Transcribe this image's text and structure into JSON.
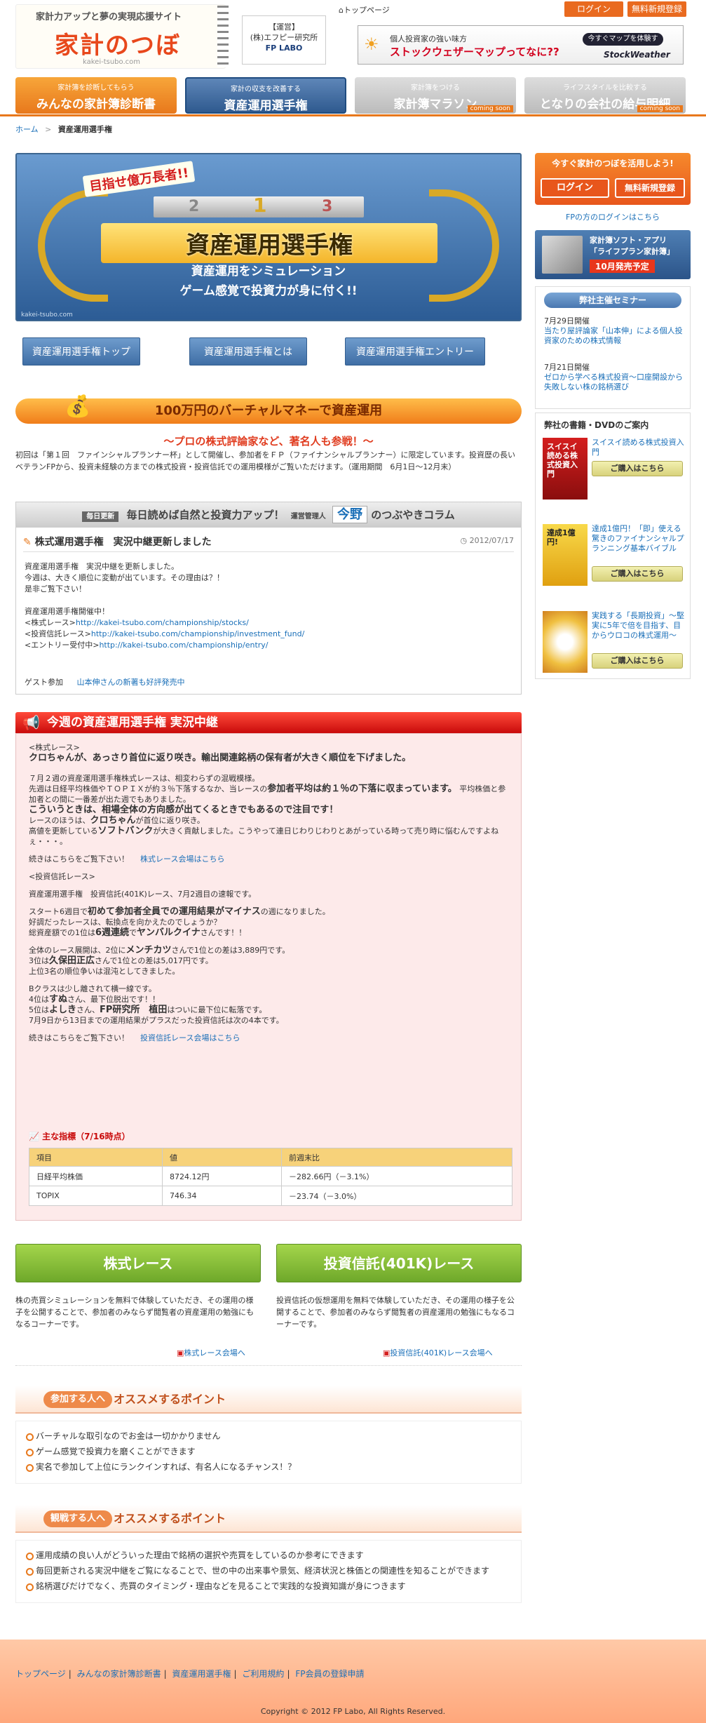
{
  "header": {
    "tagline": "家計力アップと夢の実現応援サイト",
    "logo": "家計のつぼ",
    "logo_sub": "kakei-tsubo.com",
    "sponsor_label": "【運営】",
    "sponsor_name": "(株)エフピー研究所",
    "sponsor_logo": "FP LABO",
    "top_link": "トップページ",
    "login": "ログイン",
    "register": "無料新規登録",
    "ad_line1": "個人投資家の強い味方",
    "ad_line2": "ストックウェザーマップってなに??",
    "ad_btn": "今すぐマップを体験する!!",
    "ad_logo": "StockWeather"
  },
  "nav": [
    {
      "sub": "家計簿を診断してもらう",
      "main": "みんなの家計簿診断書",
      "soon": ""
    },
    {
      "sub": "家計の収支を改善する",
      "main": "資産運用選手権",
      "soon": ""
    },
    {
      "sub": "家計簿をつける",
      "main": "家計簿マラソン",
      "soon": "coming soon"
    },
    {
      "sub": "ライフスタイルを比較する",
      "main": "となりの会社の給与明細",
      "soon": "coming soon"
    }
  ],
  "breadcrumb": {
    "home": "ホーム",
    "sep": ">",
    "current": "資産運用選手権"
  },
  "hero": {
    "tag": "目指せ億万長者!!",
    "title": "資産運用選手権",
    "sub1": "資産運用をシミュレーション",
    "sub2": "ゲーム感覚で投資力が身に付く!!",
    "url": "kakei-tsubo.com",
    "p1": "1",
    "p2": "2",
    "p3": "3"
  },
  "subnav": [
    "資産運用選手権トップ",
    "資産運用選手権とは",
    "資産運用選手権エントリー"
  ],
  "section": {
    "banner": "100万円のバーチャルマネーで資産運用",
    "pro_title": "～プロの株式評論家など、著名人も参戦！～",
    "intro": "初回は「第１回　ファインシャルプランナー杯」として開催し、参加者をＦＰ（ファイナンシャルプランナー）に限定しています。投資歴の長いベテランFPから、投資未経験の方までの株式投資・投資信託での運用模様がご覧いただけます。（運用期間　6月1日～12月末）"
  },
  "column": {
    "badge": "毎日更新",
    "head": "毎日読めば自然と投資力アップ！",
    "role": "運営管理人",
    "name": "今野",
    "suffix": "のつぶやきコラム",
    "post_title": "株式運用選手権　実況中継更新しました",
    "date": "2012/07/17",
    "body1": "資産運用選手権　実況中継を更新しました。",
    "body2": "今週は、大きく順位に変動が出ています。その理由は？！",
    "body3": "是非ご覧下さい！",
    "body4": "資産運用選手権開催中！",
    "stock_label": "<株式レース>",
    "stock_url": "http://kakei-tsubo.com/championship/stocks/",
    "fund_label": "<投資信託レース>",
    "fund_url": "http://kakei-tsubo.com/championship/investment_fund/",
    "entry_label": "<エントリー受付中>",
    "entry_url": "http://kakei-tsubo.com/championship/entry/",
    "guest_label": "ゲスト参加",
    "guest_link": "山本伸さんの新著も好評発売中"
  },
  "live": {
    "head": "今週の資産運用選手権 実況中継",
    "stock_tag": "<株式レース>",
    "lead": "クロちゃんが、あっさり首位に返り咲き。輸出関連銘柄の保有者が大きく順位を下げました。",
    "p1a": "７月２週の資産運用選手権株式レースは、相変わらずの混戦模様。",
    "p1b": "先週は日経平均株価やＴＯＰＩＸが約３％下落するなか、当レースの",
    "p1c": "参加者平均は約１％の下落に収まっています。",
    "p1d": "平均株価と参加者との間に一番差が出た週でもありました。",
    "p1e": "こういうときは、相場全体の方向感が出てくるときでもあるので注目です！",
    "p1f": "レースのほうは、",
    "p1g": "クロちゃん",
    "p1h": "が首位に返り咲き。",
    "p1i": "高値を更新している",
    "p1j": "ソフトバンク",
    "p1k": "が大きく貢献しました。こうやって連日じわりじわりとあがっている時って売り時に悩むんですよねぇ・・・。",
    "more1": "続きはこちらをご覧下さい！",
    "more1_link": "株式レース会場はこちら",
    "fund_tag": "<投資信託レース>",
    "f1": "資産運用選手権　投資信託(401K)レース、7月2週目の速報です。",
    "f2a": "スタート6週目で",
    "f2b": "初めて参加者全員での運用結果がマイナス",
    "f2c": "の週になりました。",
    "f2d": "好調だったレースは、転換点を向かえたのでしょうか？",
    "f2e": "総資産額での1位は",
    "f2f": "6週連続",
    "f2g": "で",
    "f2h": "ヤンバルクイナ",
    "f2i": "さんです！！",
    "f3a": "全体のレース展開は、2位に",
    "f3b": "メンチカツ",
    "f3c": "さんで1位との差は3,889円です。",
    "f3d": "3位は",
    "f3e": "久保田正広",
    "f3f": "さんで1位との差は5,017円です。",
    "f3g": "上位3名の順位争いは混沌としてきました。",
    "f4a": "Bクラスは少し離されて横一線です。",
    "f4b": "4位は",
    "f4c": "すぬ",
    "f4d": "さん、最下位脱出です！！",
    "f4e": "5位は",
    "f4f": "よしき",
    "f4g": "さん、",
    "f4h": "FP研究所　植田",
    "f4i": "はついに最下位に転落です。",
    "f4j": "7月9日から13日までの運用結果がプラスだった投資信託は次の4本です。",
    "more2": "続きはこちらをご覧下さい！",
    "more2_link": "投資信託レース会場はこちら",
    "idx_title": "主な指標（7/16時点）",
    "cols": [
      "項目",
      "値",
      "前週末比"
    ],
    "rows": [
      [
        "日経平均株価",
        "8724.12円",
        "－282.66円（－3.1%）"
      ],
      [
        "TOPIX",
        "746.34",
        "－23.74（－3.0%）"
      ]
    ]
  },
  "races": [
    {
      "title": "株式レース",
      "desc": "株の売買シミュレーションを無料で体験していただき、その運用の様子を公開することで、参加者のみならず閲覧者の資産運用の勉強にもなるコーナーです。",
      "link": "株式レース会場へ"
    },
    {
      "title": "投資信託(401K)レース",
      "desc": "投資信託の仮想運用を無料で体験していただき、その運用の様子を公開することで、参加者のみならず閲覧者の資産運用の勉強にもなるコーナーです。",
      "link": "投資信託(401K)レース会場へ"
    }
  ],
  "rec1": {
    "badge": "参加する人へ",
    "title": "オススメするポイント",
    "items": [
      "バーチャルな取引なのでお金は一切かかりません",
      "ゲーム感覚で投資力を磨くことができます",
      "実名で参加して上位にランクインすれば、有名人になるチャンス！？"
    ]
  },
  "rec2": {
    "badge": "観戦する人へ",
    "title": "オススメするポイント",
    "items": [
      "運用成績の良い人がどういった理由で銘柄の選択や売買をしているのか参考にできます",
      "毎回更新される実況中継をご覧になることで、世の中の出来事や景気、経済状況と株価との関連性を知ることができます",
      "銘柄選びだけでなく、売買のタイミング・理由などを見ることで実践的な投資知識が身につきます"
    ]
  },
  "sidebar": {
    "box_title": "今すぐ家計のつぼを活用しよう!",
    "login": "ログイン",
    "register": "無料新規登録",
    "fp_login": "FPの方のログインはこちら",
    "app1": "家計簿ソフト・アプリ",
    "app2": "「ライフプラン家計簿」",
    "app3": "10月発売予定",
    "seminar_head": "弊社主催セミナー",
    "seminars": [
      {
        "date": "7月29日開催",
        "title": "当たり屋評論家「山本伸」による個人投資家のための株式情報"
      },
      {
        "date": "7月21日開催",
        "title": "ゼロから学べる株式投資～口座開設から失敗しない株の銘柄選び"
      }
    ],
    "books_head": "弊社の書籍・DVDのご案内",
    "buy": "ご購入はこちら",
    "books": [
      {
        "title": "スイスイ読める株式投資入門",
        "cover": "スイスイ読める株式投資入門"
      },
      {
        "title": "達成1億円！「即」使える驚きのファイナンシャルプランニング基本バイブル",
        "cover": "達成1億円!"
      },
      {
        "title": "実践する「長期投資」～堅実に5年で倍を目指す、目からウロコの株式運用～",
        "cover": ""
      }
    ]
  },
  "footer": {
    "links": [
      "トップページ",
      "みんなの家計簿診断書",
      "資産運用選手権",
      "ご利用規約",
      "FP会員の登録申請"
    ],
    "sep": "|",
    "copy": "Copyright © 2012 FP Labo, All Rights Reserved."
  },
  "colors": {
    "accent": "#e8781c",
    "nav_active": "#2f5a8f",
    "live_red": "#c90b0b",
    "green": "#6ea82a"
  }
}
